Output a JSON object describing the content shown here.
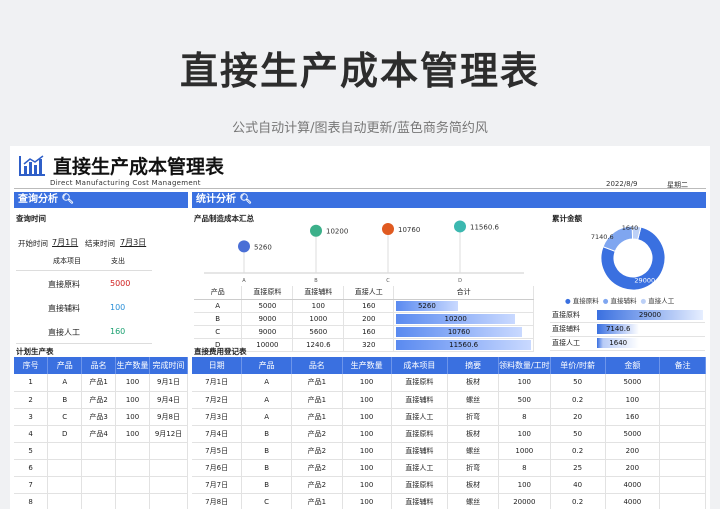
{
  "page": {
    "title": "直接生产成本管理表",
    "subtitle": "公式自动计算/图表自动更新/蓝色商务简约风"
  },
  "sheet": {
    "title": "直接生产成本管理表",
    "subtitle_en": "Direct Manufacturing Cost Management",
    "date": "2022/8/9",
    "weekday": "星期二"
  },
  "query": {
    "bar_label": "查询分析",
    "time_label": "查询时间",
    "start_label": "开始时间",
    "start_value": "7月1日",
    "end_label": "结束时间",
    "end_value": "7月3日",
    "col_item": "成本项目",
    "col_spend": "支出",
    "rows": [
      {
        "label": "直接原料",
        "value": "5000",
        "color": "#d02020"
      },
      {
        "label": "直接辅料",
        "value": "100",
        "color": "#2a8fd8"
      },
      {
        "label": "直接人工",
        "value": "160",
        "color": "#1aa070"
      }
    ]
  },
  "stats": {
    "bar_label": "统计分析",
    "product_summary_label": "产品制造成本汇总",
    "total_label": "累计金额"
  },
  "chart_data": [
    {
      "type": "scatter",
      "title": "",
      "categories": [
        "A",
        "B",
        "C",
        "D"
      ],
      "values": [
        5260,
        10200,
        10760,
        11560.6
      ],
      "value_labels": [
        "5260",
        "10200",
        "10760",
        "11560.6"
      ],
      "colors": [
        "#4a6fd6",
        "#3cb08a",
        "#e05a20",
        "#3cb8b0"
      ]
    },
    {
      "type": "pie",
      "title": "",
      "categories": [
        "直接原料",
        "直接辅料",
        "直接人工"
      ],
      "values": [
        29000,
        7140.6,
        1640
      ],
      "value_labels": [
        "29000",
        "7140.6",
        "1640"
      ],
      "colors": [
        "#3a70e0",
        "#7fa6f0",
        "#bcd0f7"
      ]
    }
  ],
  "summary": {
    "headers": [
      "产品",
      "直接原料",
      "直接辅料",
      "直接人工",
      "合计"
    ],
    "rows": [
      {
        "p": "A",
        "raw": "5000",
        "aux": "100",
        "labor": "160",
        "total": "5260",
        "pct": 0.455
      },
      {
        "p": "B",
        "raw": "9000",
        "aux": "1000",
        "labor": "200",
        "total": "10200",
        "pct": 0.882
      },
      {
        "p": "C",
        "raw": "9000",
        "aux": "5600",
        "labor": "160",
        "total": "10760",
        "pct": 0.931
      },
      {
        "p": "D",
        "raw": "10000",
        "aux": "1240.6",
        "labor": "320",
        "total": "11560.6",
        "pct": 1.0
      }
    ]
  },
  "totals": {
    "rows": [
      {
        "label": "直接原料",
        "value": "29000",
        "pct": 1.0
      },
      {
        "label": "直接辅料",
        "value": "7140.6",
        "pct": 0.246
      },
      {
        "label": "直接人工",
        "value": "1640",
        "pct": 0.057
      }
    ]
  },
  "plan": {
    "label": "计划生产表",
    "headers": [
      "序号",
      "产品",
      "品名",
      "生产数量",
      "完成时间"
    ],
    "rows": [
      [
        "1",
        "A",
        "产品1",
        "100",
        "9月1日"
      ],
      [
        "2",
        "B",
        "产品2",
        "100",
        "9月4日"
      ],
      [
        "3",
        "C",
        "产品3",
        "100",
        "9月8日"
      ],
      [
        "4",
        "D",
        "产品4",
        "100",
        "9月12日"
      ],
      [
        "5",
        "",
        "",
        "",
        ""
      ],
      [
        "6",
        "",
        "",
        "",
        ""
      ],
      [
        "7",
        "",
        "",
        "",
        ""
      ],
      [
        "8",
        "",
        "",
        "",
        ""
      ],
      [
        "9",
        "",
        "",
        "",
        ""
      ]
    ]
  },
  "ledger": {
    "label": "直接费用登记表",
    "headers": [
      "日期",
      "产品",
      "品名",
      "生产数量",
      "成本项目",
      "摘要",
      "领料数量/工时",
      "单价/时薪",
      "金额",
      "备注"
    ],
    "rows": [
      [
        "7月1日",
        "A",
        "产品1",
        "100",
        "直接原料",
        "板材",
        "100",
        "50",
        "5000",
        ""
      ],
      [
        "7月2日",
        "A",
        "产品1",
        "100",
        "直接辅料",
        "螺丝",
        "500",
        "0.2",
        "100",
        ""
      ],
      [
        "7月3日",
        "A",
        "产品1",
        "100",
        "直接人工",
        "折弯",
        "8",
        "20",
        "160",
        ""
      ],
      [
        "7月4日",
        "B",
        "产品2",
        "100",
        "直接原料",
        "板材",
        "100",
        "50",
        "5000",
        ""
      ],
      [
        "7月5日",
        "B",
        "产品2",
        "100",
        "直接辅料",
        "螺丝",
        "1000",
        "0.2",
        "200",
        ""
      ],
      [
        "7月6日",
        "B",
        "产品2",
        "100",
        "直接人工",
        "折弯",
        "8",
        "25",
        "200",
        ""
      ],
      [
        "7月7日",
        "B",
        "产品2",
        "100",
        "直接原料",
        "板材",
        "100",
        "40",
        "4000",
        ""
      ],
      [
        "7月8日",
        "C",
        "产品1",
        "100",
        "直接辅料",
        "螺丝",
        "20000",
        "0.2",
        "4000",
        ""
      ]
    ]
  }
}
